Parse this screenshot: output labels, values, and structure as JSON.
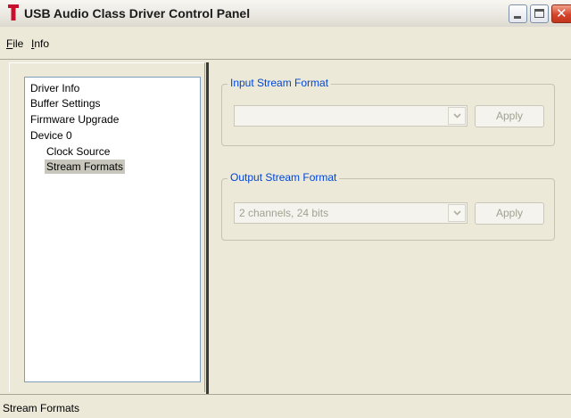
{
  "window": {
    "title": "USB Audio Class Driver Control Panel",
    "logo_icon": "red-t-logo-icon",
    "controls": {
      "minimize": "minimize-icon",
      "maximize": "maximize-icon",
      "close": "close-icon"
    },
    "close_glyph": "✕",
    "colors": {
      "title_text": "#1b1b1b",
      "group_label": "#0046d5",
      "close_button": "#d6442a",
      "logo": "#c8102e"
    }
  },
  "menu": {
    "file": {
      "mnemonic": "F",
      "rest": "ile"
    },
    "info": {
      "mnemonic": "I",
      "rest": "nfo"
    }
  },
  "tree": {
    "items": [
      "Driver Info",
      "Buffer Settings",
      "Firmware Upgrade",
      "Device 0"
    ],
    "children": [
      "Clock Source",
      "Stream Formats"
    ],
    "selected": "Stream Formats"
  },
  "input_stream": {
    "label": "Input Stream Format",
    "value": "",
    "apply_label": "Apply",
    "dropdown_icon": "chevron-down-icon"
  },
  "output_stream": {
    "label": "Output Stream Format",
    "value": "2 channels, 24 bits",
    "apply_label": "Apply",
    "dropdown_icon": "chevron-down-icon"
  },
  "status": {
    "text": "Stream Formats"
  }
}
